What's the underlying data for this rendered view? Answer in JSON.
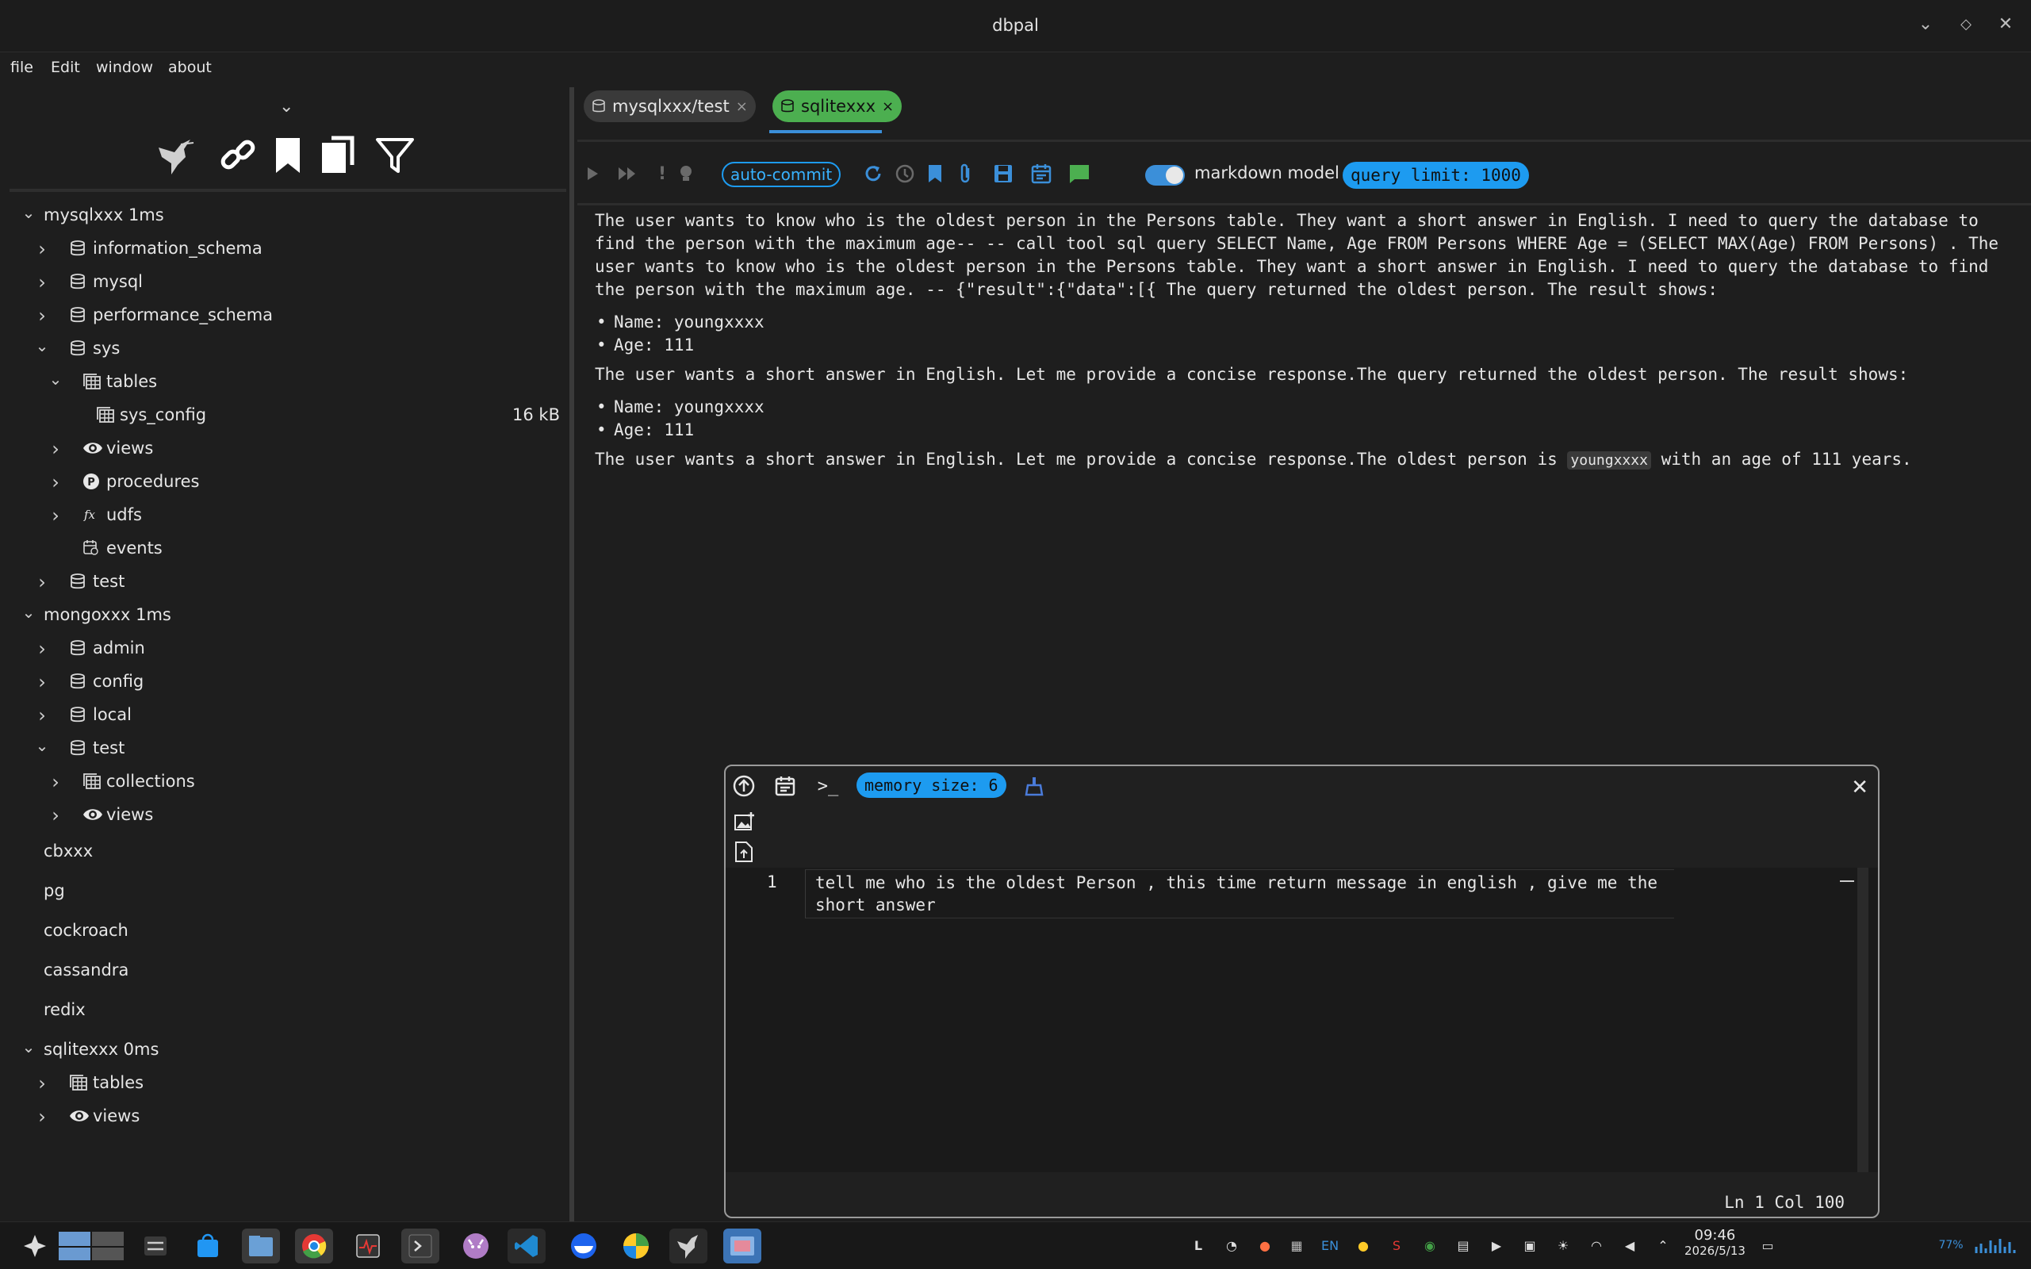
{
  "window": {
    "title": "dbpal"
  },
  "menu": {
    "items": [
      "file",
      "Edit",
      "window",
      "about"
    ]
  },
  "sidebar": {
    "icons": [
      "hummingbird-icon",
      "link-icon",
      "bookmark-icon",
      "copy-icon",
      "filter-icon"
    ],
    "tree": [
      {
        "label": "mysqlxxx 1ms",
        "depth": 0,
        "chevron": "down",
        "icon": "none"
      },
      {
        "label": "information_schema",
        "depth": 1,
        "chevron": "right",
        "icon": "database"
      },
      {
        "label": "mysql",
        "depth": 1,
        "chevron": "right",
        "icon": "database"
      },
      {
        "label": "performance_schema",
        "depth": 1,
        "chevron": "right",
        "icon": "database"
      },
      {
        "label": "sys",
        "depth": 1,
        "chevron": "down",
        "icon": "database"
      },
      {
        "label": "tables",
        "depth": 2,
        "chevron": "down",
        "icon": "table"
      },
      {
        "label": "sys_config",
        "depth": 3,
        "chevron": "none",
        "icon": "table",
        "size": "16 kB"
      },
      {
        "label": "views",
        "depth": 2,
        "chevron": "right",
        "icon": "eye"
      },
      {
        "label": "procedures",
        "depth": 2,
        "chevron": "right",
        "icon": "procedure"
      },
      {
        "label": "udfs",
        "depth": 2,
        "chevron": "right",
        "icon": "function"
      },
      {
        "label": "events",
        "depth": 2,
        "chevron": "none",
        "icon": "calendar"
      },
      {
        "label": "test",
        "depth": 1,
        "chevron": "right",
        "icon": "database"
      },
      {
        "label": "mongoxxx 1ms",
        "depth": 0,
        "chevron": "down",
        "icon": "none"
      },
      {
        "label": "admin",
        "depth": 1,
        "chevron": "right",
        "icon": "database"
      },
      {
        "label": "config",
        "depth": 1,
        "chevron": "right",
        "icon": "database"
      },
      {
        "label": "local",
        "depth": 1,
        "chevron": "right",
        "icon": "database"
      },
      {
        "label": "test",
        "depth": 1,
        "chevron": "down",
        "icon": "database"
      },
      {
        "label": "collections",
        "depth": 2,
        "chevron": "right",
        "icon": "table"
      },
      {
        "label": "views",
        "depth": 2,
        "chevron": "right",
        "icon": "eye"
      },
      {
        "label": "cbxxx",
        "depth": 0,
        "chevron": "none",
        "icon": "none"
      },
      {
        "label": "pg",
        "depth": 0,
        "chevron": "none",
        "icon": "none"
      },
      {
        "label": "cockroach",
        "depth": 0,
        "chevron": "none",
        "icon": "none"
      },
      {
        "label": "cassandra",
        "depth": 0,
        "chevron": "none",
        "icon": "none"
      },
      {
        "label": "redix",
        "depth": 0,
        "chevron": "none",
        "icon": "none"
      },
      {
        "label": "sqlitexxx 0ms",
        "depth": 0,
        "chevron": "down",
        "icon": "none"
      },
      {
        "label": "tables",
        "depth": 1,
        "chevron": "right",
        "icon": "table"
      },
      {
        "label": "views",
        "depth": 1,
        "chevron": "right",
        "icon": "eye"
      }
    ]
  },
  "tabs": [
    {
      "label": "mysqlxxx/test",
      "active": false
    },
    {
      "label": "sqlitexxx",
      "active": true
    }
  ],
  "toolbar": {
    "auto_commit": "auto-commit",
    "markdown_label": "markdown model",
    "markdown_enabled": true,
    "query_limit": "query limit: 1000"
  },
  "output": {
    "p1": "The user wants to know who is the oldest person in the Persons table. They want a short answer in English. I need to query the database to find the person with the maximum age-- -- call tool sql query SELECT Name, Age FROM Persons WHERE Age = (SELECT MAX(Age) FROM Persons) . The user wants to know who is the oldest person in the Persons table. They want a short answer in English. I need to query the database to find the person with the maximum age. -- {\"result\":{\"data\":[{ The query returned the oldest person. The result shows:",
    "list1": [
      "Name: youngxxxx",
      "Age: 111"
    ],
    "p2": "The user wants a short answer in English. Let me provide a concise response.The query returned the oldest person. The result shows:",
    "list2": [
      "Name: youngxxxx",
      "Age: 111"
    ],
    "p3_before": "The user wants a short answer in English. Let me provide a concise response.The oldest person is ",
    "p3_code": "youngxxxx",
    "p3_after": " with an age of 111 years."
  },
  "chat": {
    "memory_size": "memory size: 6",
    "line_number": "1",
    "input_text": "tell me who is the oldest Person , this time return message in english , give me the short answer",
    "status": "Ln 1 Col 100"
  },
  "taskbar": {
    "time": "09:46",
    "date": "2026/5/13",
    "lang": "EN",
    "battery": "77%"
  },
  "colors": {
    "accent": "#1d9bf0",
    "active_tab": "#4caf50",
    "background": "#1e1e1e"
  }
}
